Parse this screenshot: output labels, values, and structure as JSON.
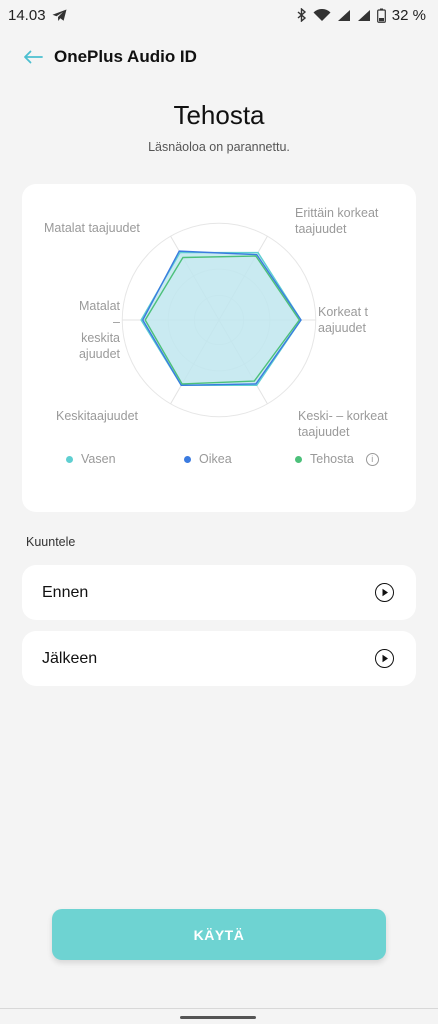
{
  "status_bar": {
    "time": "14.03",
    "icons": [
      "telegram-icon",
      "bluetooth-icon",
      "wifi-icon",
      "signal-icon",
      "signal-icon",
      "battery-icon"
    ],
    "battery": "32 %"
  },
  "header": {
    "title": "OnePlus Audio ID"
  },
  "hero": {
    "title": "Tehosta",
    "subtitle": "Läsnäoloa on parannettu."
  },
  "chart_data": {
    "type": "radar",
    "axes": [
      "Matalat taajuudet",
      "Erittäin korkeat taajuudet",
      "Korkeat taajuudet",
      "Keski- – korkeat taajuudet",
      "Keskitaajuudet",
      "Matalat – keskitaajuudet"
    ],
    "axis_labels": {
      "low": "Matalat taajuudet",
      "very_high_1": "Erittäin korkeat",
      "very_high_2": "taajuudet",
      "high_1": "Korkeat t",
      "high_2": "aajuudet",
      "mid_high_1": "Keski- – korkeat",
      "mid_high_2": "taajuudet",
      "mid": "Keskitaajuudet",
      "low_mid_1": "Matalat",
      "low_mid_2": "– keskita",
      "low_mid_3": "ajuudet"
    },
    "series": [
      {
        "name": "Vasen",
        "color": "#5fcfd1",
        "values": [
          0.95,
          0.95,
          1.0,
          0.92,
          0.92,
          0.95
        ]
      },
      {
        "name": "Oikea",
        "color": "#3b7be0",
        "values": [
          0.97,
          0.92,
          1.0,
          0.9,
          0.92,
          0.93
        ]
      },
      {
        "name": "Tehosta",
        "color": "#4cc07a",
        "values": [
          0.88,
          0.9,
          0.98,
          0.86,
          0.9,
          0.9
        ]
      }
    ],
    "range": [
      0,
      1
    ],
    "grid": true
  },
  "legend": {
    "left": "Vasen",
    "right": "Oikea",
    "enhance": "Tehosta"
  },
  "listen": {
    "label": "Kuuntele",
    "before": "Ennen",
    "after": "Jälkeen"
  },
  "apply_button": "KÄYTÄ"
}
